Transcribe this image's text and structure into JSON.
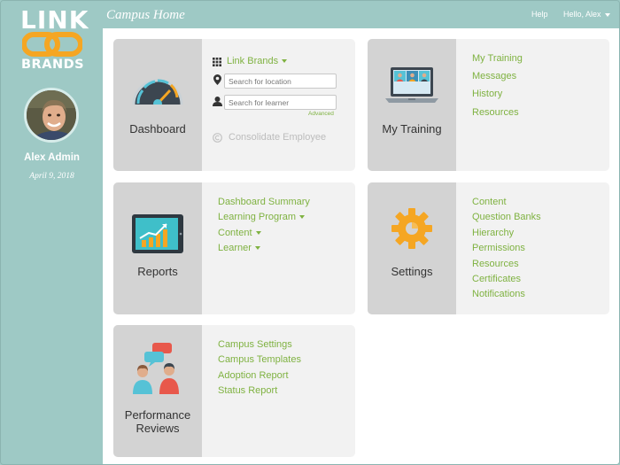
{
  "sidebar": {
    "logo_top": "LINK",
    "logo_bottom": "BRANDS",
    "user_name": "Alex Admin",
    "date": "April 9, 2018"
  },
  "header": {
    "title": "Campus Home",
    "help": "Help",
    "user_menu": "Hello, Alex"
  },
  "cards": {
    "dashboard": {
      "title": "Dashboard",
      "brand_select": "Link Brands",
      "location_placeholder": "Search for location",
      "learner_placeholder": "Search for learner",
      "advanced": "Advanced",
      "consolidate": "Consolidate Employee"
    },
    "my_training": {
      "title": "My Training",
      "links": [
        "My Training",
        "Messages",
        "History",
        "Resources"
      ]
    },
    "reports": {
      "title": "Reports",
      "links": [
        "Dashboard Summary",
        "Learning Program",
        "Content",
        "Learner"
      ]
    },
    "settings": {
      "title": "Settings",
      "links": [
        "Content",
        "Question Banks",
        "Hierarchy",
        "Permissions",
        "Resources",
        "Certificates",
        "Notifications"
      ]
    },
    "performance": {
      "title_line1": "Performance",
      "title_line2": "Reviews",
      "links": [
        "Campus Settings",
        "Campus Templates",
        "Adoption Report",
        "Status Report"
      ]
    }
  },
  "colors": {
    "sidebar_bg": "#9ec9c5",
    "link_green": "#7fb241",
    "logo_orange": "#f5a623",
    "card_bg": "#f2f2f2",
    "icon_panel_bg": "#d3d3d3"
  }
}
